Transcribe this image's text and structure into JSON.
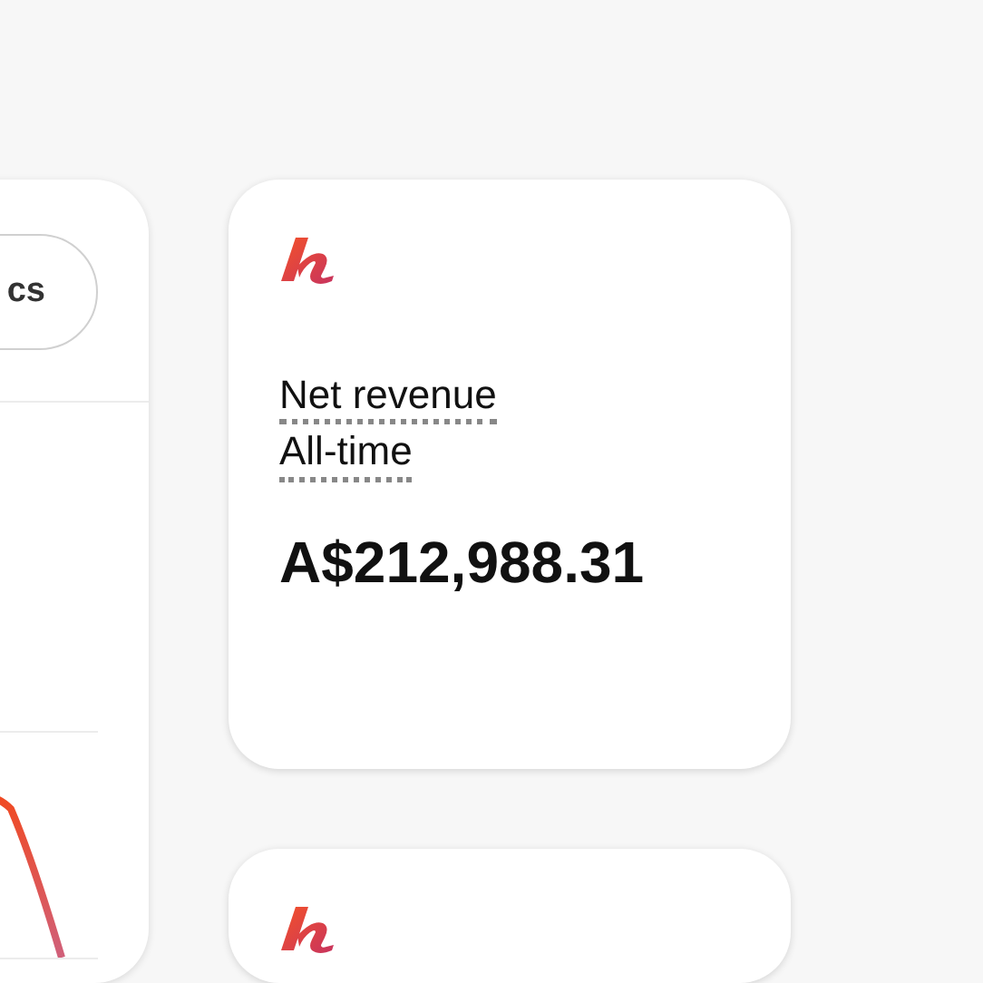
{
  "left_panel": {
    "button": {
      "label": "cs"
    }
  },
  "cards": [
    {
      "kind": "metric",
      "label": "Net revenue",
      "period": "All-time",
      "value": "A$212,988.31"
    },
    {
      "kind": "metric"
    }
  ]
}
